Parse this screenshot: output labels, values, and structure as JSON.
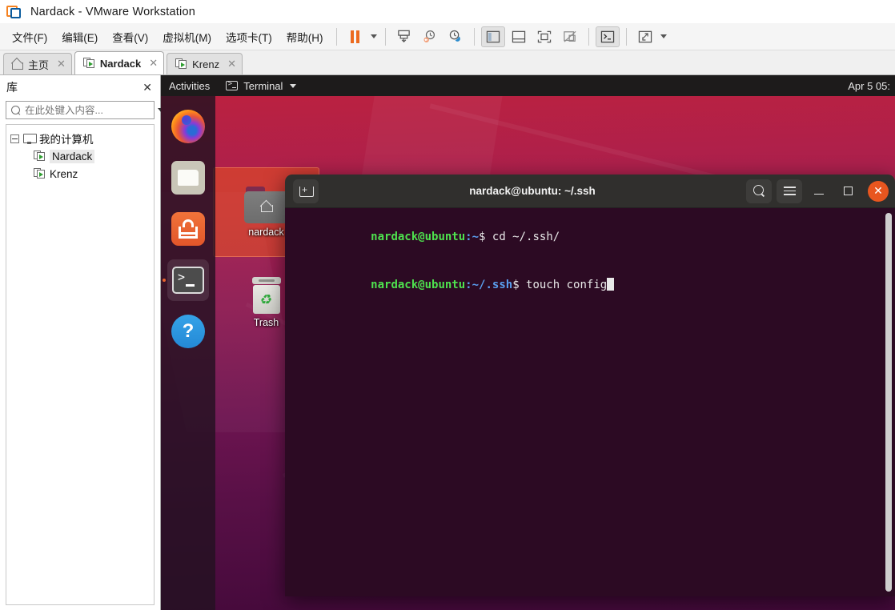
{
  "window": {
    "title": "Nardack - VMware Workstation",
    "logo_icon": "vmware-logo-icon"
  },
  "menubar": {
    "items": [
      {
        "label": "文件(F)",
        "name": "menu-file"
      },
      {
        "label": "编辑(E)",
        "name": "menu-edit"
      },
      {
        "label": "查看(V)",
        "name": "menu-view"
      },
      {
        "label": "虚拟机(M)",
        "name": "menu-vm"
      },
      {
        "label": "选项卡(T)",
        "name": "menu-tabs"
      },
      {
        "label": "帮助(H)",
        "name": "menu-help"
      }
    ],
    "toolbar": {
      "pause": "pause-icon",
      "pause_dropdown": "chevron-down-icon",
      "snapshot_take": "snapshot-take-icon",
      "snapshot_revert": "snapshot-revert-icon",
      "snapshot_manager": "snapshot-manager-icon",
      "show_library": "show-library-icon",
      "show_thumbnails": "show-thumbnail-bar-icon",
      "show_console": "show-console-view-icon",
      "hide_console": "hide-console-view-icon",
      "send_ctrl_alt_del": "terminal-console-icon",
      "fullscreen": "enter-fullscreen-icon",
      "fullscreen_dropdown": "chevron-down-icon"
    }
  },
  "tabs": [
    {
      "label": "主页",
      "icon": "home-icon",
      "active": false,
      "close": "✕"
    },
    {
      "label": "Nardack",
      "icon": "vm-icon",
      "active": true,
      "close": "✕"
    },
    {
      "label": "Krenz",
      "icon": "vm-icon",
      "active": false,
      "close": "✕"
    }
  ],
  "library": {
    "title": "库",
    "close_label": "✕",
    "search": {
      "placeholder": "在此处键入内容...",
      "value": "",
      "icon": "search-icon",
      "dropdown_icon": "chevron-down-icon"
    },
    "tree": {
      "root": {
        "label": "我的计算机",
        "icon": "computer-icon",
        "expanded": true
      },
      "children": [
        {
          "label": "Nardack",
          "icon": "vm-icon",
          "selected": true
        },
        {
          "label": "Krenz",
          "icon": "vm-icon",
          "selected": false
        }
      ]
    }
  },
  "guest": {
    "topbar": {
      "activities": "Activities",
      "app_name": "Terminal",
      "app_icon": "terminal-icon",
      "app_caret": "chevron-down-icon",
      "clock": "Apr 5 05:"
    },
    "dock": [
      {
        "name": "dock-item-firefox",
        "label": "Firefox",
        "icon": "firefox-icon",
        "active": false
      },
      {
        "name": "dock-item-files",
        "label": "Files",
        "icon": "files-icon",
        "active": false
      },
      {
        "name": "dock-item-software",
        "label": "Ubuntu Software",
        "icon": "ubuntu-software-icon",
        "active": false
      },
      {
        "name": "dock-item-terminal",
        "label": "Terminal",
        "icon": "terminal-icon",
        "active": true
      },
      {
        "name": "dock-item-help",
        "label": "Help",
        "icon": "help-icon",
        "active": false
      }
    ],
    "desktop_icons": [
      {
        "label": "nardack",
        "icon": "home-folder-icon",
        "selected": true
      },
      {
        "label": "Trash",
        "icon": "trash-icon",
        "selected": false
      }
    ],
    "terminal": {
      "title": "nardack@ubuntu: ~/.ssh",
      "new_tab_icon": "new-tab-icon",
      "search_icon": "search-icon",
      "menu_icon": "hamburger-menu-icon",
      "minimize_icon": "minimize-icon",
      "maximize_icon": "maximize-icon",
      "close_icon": "close-icon",
      "lines": [
        {
          "prompt_user": "nardack@ubuntu",
          "prompt_path": ":~",
          "prompt_sym": "$ ",
          "command": "cd ~/.ssh/"
        },
        {
          "prompt_user": "nardack@ubuntu",
          "prompt_path": ":~/.ssh",
          "prompt_sym": "$ ",
          "command": "touch config"
        }
      ]
    }
  },
  "colors": {
    "accent_orange": "#e8561f",
    "prompt_green": "#4ee24e",
    "prompt_blue": "#5a9ff0",
    "terminal_bg": "#2c0a23"
  }
}
